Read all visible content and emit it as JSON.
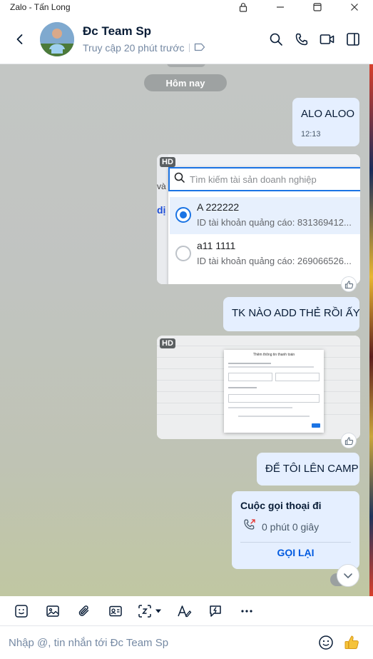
{
  "window": {
    "title": "Zalo - Tấn Long"
  },
  "header": {
    "name": "Đc Team Sp",
    "status": "Truy cập 20 phút trước"
  },
  "chat": {
    "date_divider": "Hôm nay",
    "messages": [
      {
        "type": "text",
        "text": "ALO ALOO",
        "time": "12:13"
      },
      {
        "type": "image",
        "badge": "HD",
        "content": {
          "search_placeholder": "Tìm kiếm tài sản doanh nghiệp",
          "options": [
            {
              "name": "A 222222",
              "id": "ID tài khoản quảng cáo: 831369412...",
              "selected": true
            },
            {
              "name": "a11 1111",
              "id": "ID tài khoản quảng cáo: 269066526...",
              "selected": false
            }
          ],
          "partial_left_label": "dị",
          "partial_left_label2": "và"
        }
      },
      {
        "type": "text",
        "text": "TK NÀO ADD THẺ RỒI ẤY"
      },
      {
        "type": "image",
        "badge": "HD",
        "content": {
          "dialog_title": "Thêm thông tin thanh toán"
        }
      },
      {
        "type": "text",
        "text": "ĐỂ TÔI LÊN CAMP"
      },
      {
        "type": "call",
        "title": "Cuộc gọi thoại đi",
        "duration": "0 phút 0 giây",
        "action": "GỌI LẠI"
      }
    ]
  },
  "composer": {
    "placeholder": "Nhập @, tin nhắn tới Đc Team Sp"
  },
  "colors": {
    "accent": "#005ae0",
    "bubble": "#e5efff",
    "fb_blue": "#1b74e4"
  },
  "icons": {
    "titlebar": [
      "lock-icon",
      "minimize-icon",
      "maximize-icon",
      "close-icon"
    ],
    "header": [
      "back-icon",
      "search-icon",
      "phone-icon",
      "video-call-icon",
      "sidebar-toggle-icon"
    ],
    "toolbar": [
      "sticker-icon",
      "image-icon",
      "attach-icon",
      "contact-card-icon",
      "screenshot-icon",
      "format-text-icon",
      "quick-message-icon",
      "more-icon"
    ],
    "composer": [
      "emoji-icon",
      "thumbs-up-icon"
    ]
  }
}
